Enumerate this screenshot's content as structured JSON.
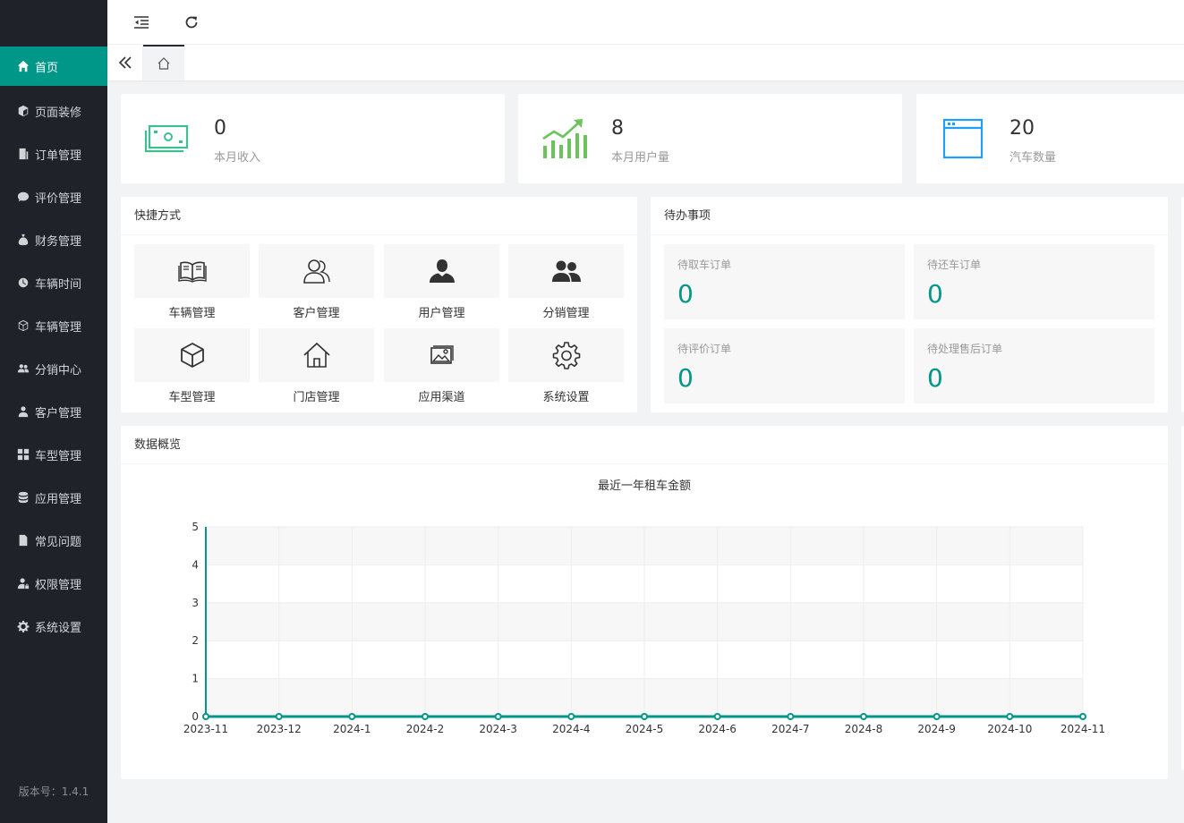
{
  "sidebar": {
    "items": [
      {
        "label": "首页",
        "icon": "home-icon"
      },
      {
        "label": "页面装修",
        "icon": "cube-icon"
      },
      {
        "label": "订单管理",
        "icon": "document-icon"
      },
      {
        "label": "评价管理",
        "icon": "comment-icon"
      },
      {
        "label": "财务管理",
        "icon": "moneybag-icon"
      },
      {
        "label": "车辆时间",
        "icon": "clock-icon"
      },
      {
        "label": "车辆管理",
        "icon": "cube-outline-icon"
      },
      {
        "label": "分销中心",
        "icon": "users-icon"
      },
      {
        "label": "客户管理",
        "icon": "user-icon"
      },
      {
        "label": "车型管理",
        "icon": "grid-icon"
      },
      {
        "label": "应用管理",
        "icon": "database-icon"
      },
      {
        "label": "常见问题",
        "icon": "file-icon"
      },
      {
        "label": "权限管理",
        "icon": "user-lock-icon"
      },
      {
        "label": "系统设置",
        "icon": "gear-icon"
      }
    ],
    "version": "版本号：1.4.1"
  },
  "stats": [
    {
      "value": "0",
      "label": "本月收入",
      "icon": "money-icon",
      "color": "#3dbf8f"
    },
    {
      "value": "8",
      "label": "本月用户量",
      "icon": "growth-chart-icon",
      "color": "#6cc25b"
    },
    {
      "value": "20",
      "label": "汽车数量",
      "icon": "browser-window-icon",
      "color": "#1e9fff"
    }
  ],
  "shortcuts": {
    "title": "快捷方式",
    "items": [
      {
        "label": "车辆管理",
        "icon": "book-icon"
      },
      {
        "label": "客户管理",
        "icon": "users-outline-icon"
      },
      {
        "label": "用户管理",
        "icon": "user-icon"
      },
      {
        "label": "分销管理",
        "icon": "group-icon"
      },
      {
        "label": "车型管理",
        "icon": "box-icon"
      },
      {
        "label": "门店管理",
        "icon": "house-icon"
      },
      {
        "label": "应用渠道",
        "icon": "picture-icon"
      },
      {
        "label": "系统设置",
        "icon": "gear-icon"
      }
    ]
  },
  "todos": {
    "title": "待办事项",
    "items": [
      {
        "label": "待取车订单",
        "value": "0"
      },
      {
        "label": "待还车订单",
        "value": "0"
      },
      {
        "label": "待评价订单",
        "value": "0"
      },
      {
        "label": "待处理售后订单",
        "value": "0"
      }
    ]
  },
  "overview": {
    "title": "数据概览"
  },
  "colors": {
    "accent": "#009688",
    "sidebar": "#20222a"
  },
  "chart_data": {
    "type": "line",
    "title": "最近一年租车金额",
    "xlabel": "",
    "ylabel": "",
    "categories": [
      "2023-11",
      "2023-12",
      "2024-1",
      "2024-2",
      "2024-3",
      "2024-4",
      "2024-5",
      "2024-6",
      "2024-7",
      "2024-8",
      "2024-9",
      "2024-10",
      "2024-11"
    ],
    "values": [
      0,
      0,
      0,
      0,
      0,
      0,
      0,
      0,
      0,
      0,
      0,
      0,
      0
    ],
    "y_ticks": [
      "0",
      "1",
      "2",
      "3",
      "4",
      "5"
    ],
    "ylim": [
      0,
      5
    ],
    "grid": true,
    "legend": "none"
  }
}
